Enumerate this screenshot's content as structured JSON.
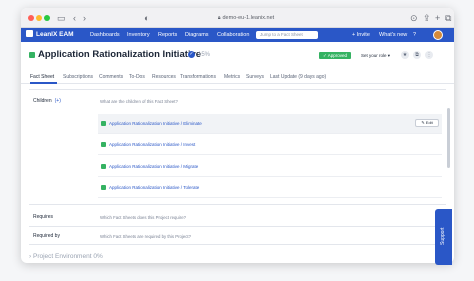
{
  "browser": {
    "url": "demo-eu-1.leanix.net"
  },
  "appnav": {
    "brand": "LeanIX EAM",
    "items": [
      "Dashboards",
      "Inventory",
      "Reports",
      "Diagrams",
      "Collaboration"
    ],
    "search_placeholder": "Jump to a Fact Sheet",
    "invite": "+ Invite",
    "whats_new": "What's new"
  },
  "header": {
    "title": "Application Rationalization Initiative",
    "completion": "15%",
    "status": "Approved",
    "role": "Set your role"
  },
  "tabs": [
    "Fact Sheet",
    "Subscriptions",
    "Comments",
    "To-Dos",
    "Resources",
    "Transformations",
    "Metrics",
    "Surveys",
    "Last Update (9 days ago)"
  ],
  "children": {
    "label": "Children",
    "add_icon": "plus-icon",
    "helper": "What are the children of this Fact Sheet?",
    "items": [
      "Application Rationalization Initiative / Eliminate",
      "Application Rationalization Initiative / Invest",
      "Application Rationalization Initiative / Migrate",
      "Application Rationalization Initiative / Tolerate"
    ],
    "edit_label": "Edit"
  },
  "requires": {
    "label": "Requires",
    "helper": "Which Fact Sheets does this Project require?"
  },
  "required_by": {
    "label": "Required by",
    "helper": "Which Fact Sheets are required by this Project?"
  },
  "section": {
    "title": "Project Environment",
    "completion": "0%"
  },
  "support": "Support",
  "colors": {
    "brand": "#2a57c7",
    "status_green": "#35b262"
  }
}
